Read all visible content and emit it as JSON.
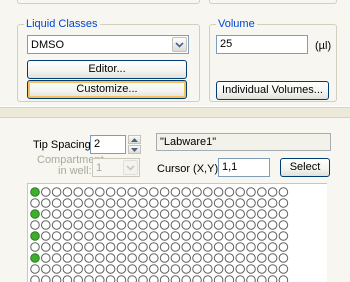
{
  "liquid_classes": {
    "legend": "Liquid Classes",
    "selected": "DMSO",
    "editor_label": "Editor...",
    "customize_label": "Customize..."
  },
  "volume": {
    "legend": "Volume",
    "value": "25",
    "unit": "(µl)",
    "individual_label": "Individual Volumes..."
  },
  "labware": {
    "tip_spacing_label": "Tip Spacing:",
    "tip_spacing_value": "2",
    "labware_name": "\"Labware1\"",
    "compartment_label_1": "Compartment",
    "compartment_label_2": "in well:",
    "compartment_value": "1",
    "cursor_label": "Cursor (X,Y):",
    "cursor_value": "1,1",
    "select_label": "Select"
  },
  "plate": {
    "rows_visible": 8,
    "cols": 24,
    "selected_column": 1,
    "selected_rows_visible": [
      1,
      3,
      5,
      7
    ],
    "selected_color": "#3fae2f",
    "empty_color": "#ffffff"
  }
}
